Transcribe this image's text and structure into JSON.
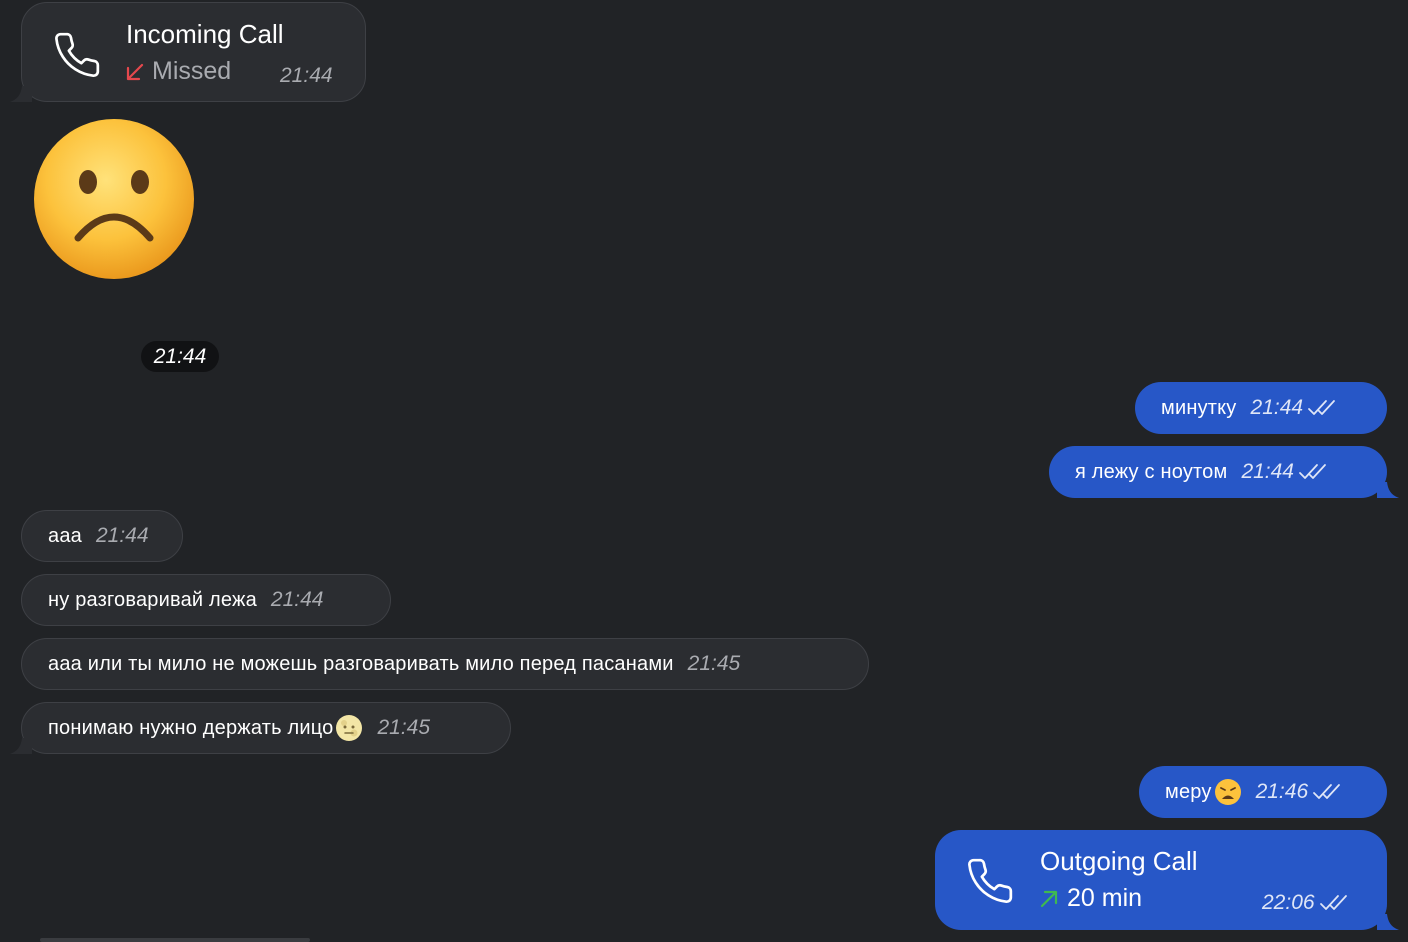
{
  "incoming_call": {
    "title": "Incoming Call",
    "status": "Missed",
    "time": "21:44",
    "arrow_color": "#e5484d",
    "icon": "phone-icon"
  },
  "sticker": {
    "icon": "frowning-face-emoji"
  },
  "time_pill": "21:44",
  "messages": [
    {
      "side": "out",
      "text": "минутку",
      "time": "21:44",
      "read": true
    },
    {
      "side": "out",
      "text": "я лежу с ноутом",
      "time": "21:44",
      "read": true
    },
    {
      "side": "in",
      "text": "ааа",
      "time": "21:44"
    },
    {
      "side": "in",
      "text": "ну разговаривай лежа",
      "time": "21:44"
    },
    {
      "side": "in",
      "text": "ааа или ты мило не можешь разговаривать мило перед пасанами",
      "time": "21:45"
    },
    {
      "side": "in",
      "text": "понимаю нужно держать лицо",
      "time": "21:45",
      "emoji": "moon-face-emoji"
    },
    {
      "side": "out",
      "text": "меру",
      "time": "21:46",
      "read": true,
      "emoji": "weary-face-emoji"
    }
  ],
  "outgoing_call": {
    "title": "Outgoing Call",
    "duration": "20 min",
    "time": "22:06",
    "arrow_color": "#3fb950",
    "icon": "phone-icon",
    "read": true
  },
  "colors": {
    "background": "#212326",
    "incoming_bubble": "#2b2d31",
    "outgoing_bubble": "#2757c7"
  }
}
